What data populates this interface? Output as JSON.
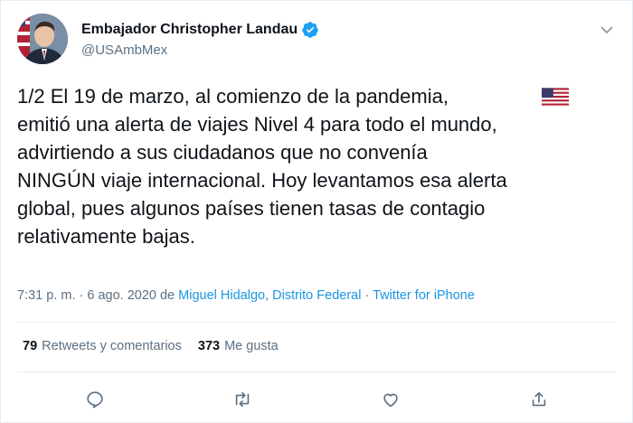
{
  "author": {
    "name": "Embajador Christopher Landau",
    "handle": "@USAmbMex"
  },
  "tweet": {
    "text": "1/2 El 19 de marzo, al comienzo de la pandemia, \nemitió una alerta de viajes Nivel 4 para todo el mundo,\nadvirtiendo a sus ciudadanos que no convenía\nNINGÚN viaje internacional. Hoy levantamos esa alerta\nglobal, pues algunos países tienen tasas de contagio\nrelativamente bajas.",
    "flag_icon": "us-flag-icon"
  },
  "meta": {
    "time_date": "7:31 p. m. · 6 ago. 2020 de ",
    "location": "Miguel Hidalgo, Distrito Federal",
    "separator": " · ",
    "source": "Twitter for iPhone"
  },
  "stats": {
    "retweets_count": "79",
    "retweets_label": "Retweets y comentarios",
    "likes_count": "373",
    "likes_label": "Me gusta"
  },
  "actions": [
    "reply-icon",
    "retweet-icon",
    "like-icon",
    "share-icon"
  ],
  "colors": {
    "link": "#1b95e0",
    "secondary_text": "#5b7083",
    "verified": "#1da1f2"
  }
}
